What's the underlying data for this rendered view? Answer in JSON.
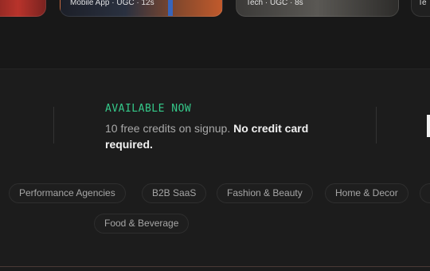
{
  "carousel": {
    "cards": [
      {
        "caption": ""
      },
      {
        "caption": "Mobile App · UGC · 12s"
      },
      {
        "caption": "Tech · UGC · 8s"
      },
      {
        "caption": "Te"
      }
    ]
  },
  "availability": {
    "eyebrow": "AVAILABLE NOW",
    "text": "10 free credits on signup.",
    "emphasis": "No credit card required."
  },
  "industries": [
    {
      "label": "Performance Agencies"
    },
    {
      "label": "B2B SaaS"
    },
    {
      "label": "Fashion & Beauty"
    },
    {
      "label": "Home & Decor"
    },
    {
      "label": ""
    },
    {
      "label": "Food & Beverage"
    }
  ],
  "colors": {
    "background": "#1c1c1c",
    "accent_green": "#35c98a",
    "chip_border": "#2e2e2e"
  }
}
